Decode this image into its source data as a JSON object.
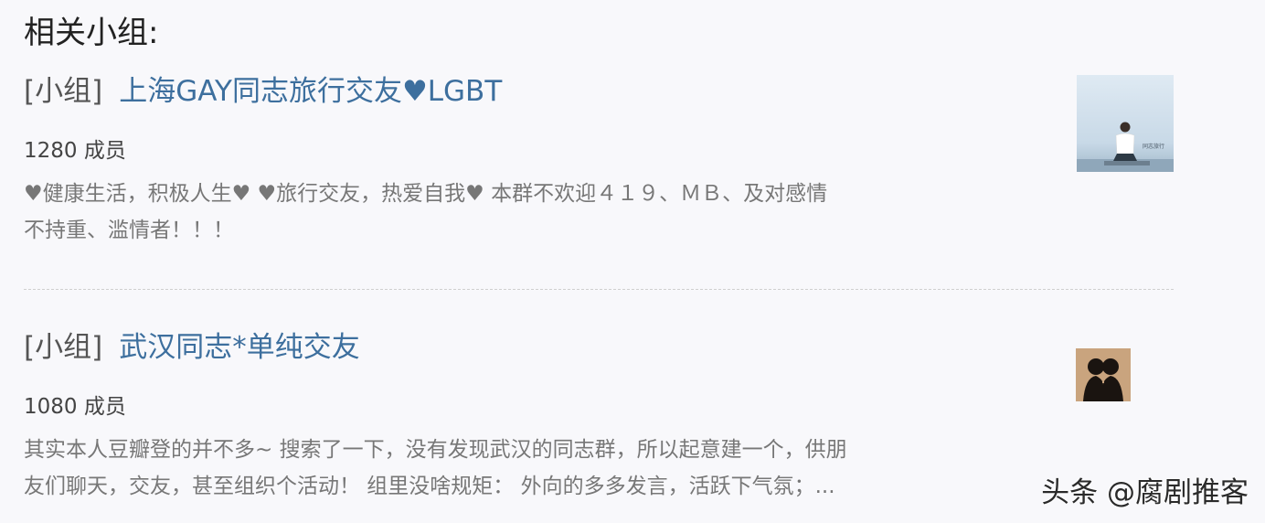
{
  "section_title": "相关小组:",
  "groups": [
    {
      "tag": "[小组]",
      "name": "上海GAY同志旅行交友",
      "name_heart": "♥",
      "name_suffix": "LGBT",
      "members": "1280 成员",
      "desc_line1": "♥健康生活，积极人生♥ ♥旅行交友，热爱自我♥ 本群不欢迎４１９、ＭＢ、及对感情",
      "desc_line2": "不持重、滥情者！！！",
      "thumb_text": "同志旅行"
    },
    {
      "tag": "[小组]",
      "name": "武汉同志*单纯交友",
      "members": "1080 成员",
      "desc_line1": "其实本人豆瓣登的并不多~ 搜索了一下，没有发现武汉的同志群，所以起意建一个，供朋",
      "desc_line2": "友们聊天，交友，甚至组织个活动！ 组里没啥规矩： 外向的多多发言，活跃下气氛；..."
    }
  ],
  "watermark": "头条 @腐剧推客",
  "colors": {
    "link": "#3d6f9e",
    "background": "#f8f8fb",
    "heart_grey": "#8a8a8a"
  }
}
